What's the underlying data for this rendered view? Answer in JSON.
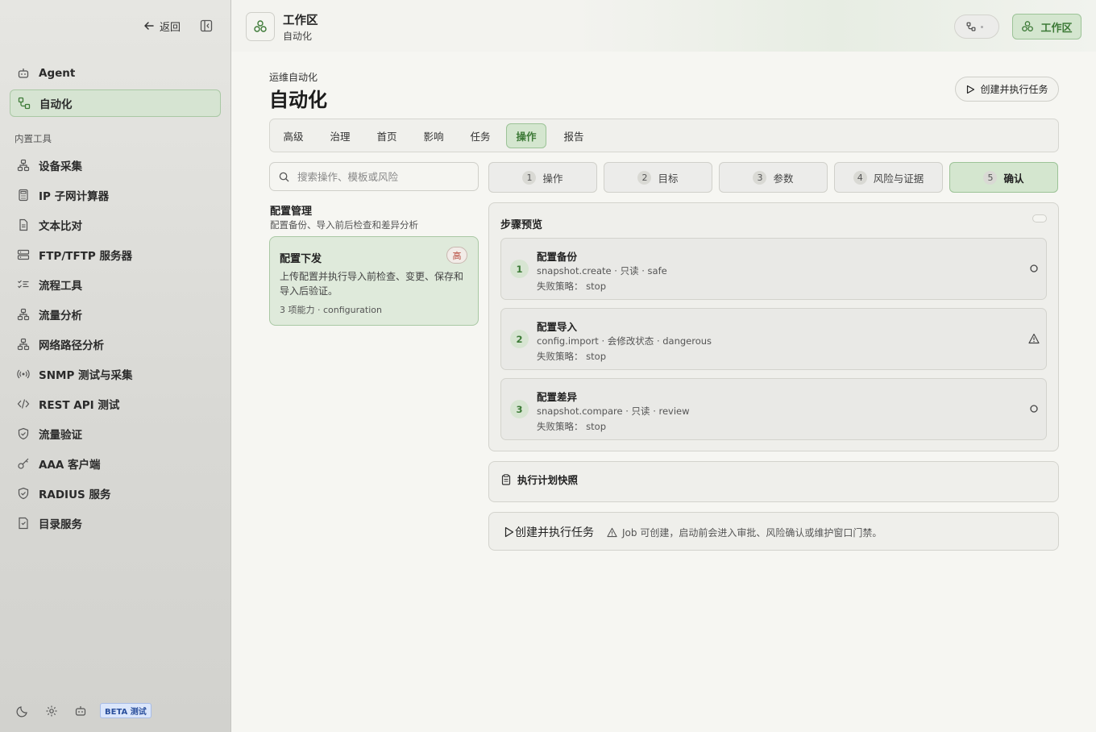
{
  "sidebar": {
    "back_label": "返回",
    "section_label": "内置工具",
    "top_items": [
      {
        "label": "Agent",
        "icon": "robot-icon"
      },
      {
        "label": "自动化",
        "icon": "workflow-icon"
      }
    ],
    "tools": [
      {
        "label": "设备采集",
        "icon": "topology-icon"
      },
      {
        "label": "IP 子网计算器",
        "icon": "calculator-icon"
      },
      {
        "label": "文本比对",
        "icon": "document-icon"
      },
      {
        "label": "FTP/TFTP 服务器",
        "icon": "server-icon"
      },
      {
        "label": "流程工具",
        "icon": "list-check-icon"
      },
      {
        "label": "流量分析",
        "icon": "topology-icon"
      },
      {
        "label": "网络路径分析",
        "icon": "topology-icon"
      },
      {
        "label": "SNMP 测试与采集",
        "icon": "radio-icon"
      },
      {
        "label": "REST API 测试",
        "icon": "code-icon"
      },
      {
        "label": "流量验证",
        "icon": "shield-check-icon"
      },
      {
        "label": "AAA 客户端",
        "icon": "key-icon"
      },
      {
        "label": "RADIUS 服务",
        "icon": "shield-check-icon"
      },
      {
        "label": "目录服务",
        "icon": "directory-icon"
      }
    ],
    "beta_label": "BETA 测试"
  },
  "header": {
    "workspace_title": "工作区",
    "workspace_sub": "自动化",
    "workspace_button": "工作区"
  },
  "page": {
    "overline": "运维自动化",
    "title": "自动化",
    "create_button": "创建并执行任务"
  },
  "tabs": [
    "高级",
    "治理",
    "首页",
    "影响",
    "任务",
    "操作",
    "报告"
  ],
  "active_tab": "操作",
  "search": {
    "placeholder": "搜索操作、模板或风险",
    "value": ""
  },
  "wizard_steps": [
    {
      "num": "1",
      "label": "操作"
    },
    {
      "num": "2",
      "label": "目标"
    },
    {
      "num": "3",
      "label": "参数"
    },
    {
      "num": "4",
      "label": "风险与证据"
    },
    {
      "num": "5",
      "label": "确认"
    }
  ],
  "config": {
    "heading": "配置管理",
    "description": "配置备份、导入前后检查和差异分析",
    "card": {
      "title": "配置下发",
      "risk": "高",
      "text": "上传配置并执行导入前检查、变更、保存和导入后验证。",
      "meta": "3 项能力 · configuration"
    }
  },
  "preview": {
    "title": "步骤预览",
    "steps": [
      {
        "num": "1",
        "title": "配置备份",
        "meta": "snapshot.create · 只读 · safe",
        "policy": "失败策略： stop",
        "icon": "circle-icon"
      },
      {
        "num": "2",
        "title": "配置导入",
        "meta": "config.import · 会修改状态 · dangerous",
        "policy": "失败策略： stop",
        "icon": "warning-icon"
      },
      {
        "num": "3",
        "title": "配置差异",
        "meta": "snapshot.compare · 只读 · review",
        "policy": "失败策略： stop",
        "icon": "circle-icon"
      }
    ]
  },
  "snapshot": {
    "title": "执行计划快照"
  },
  "action": {
    "button": "创建并执行任务",
    "note": "Job 可创建，启动前会进入审批、风险确认或维护窗口门禁。"
  },
  "colors": {
    "accent": "#3d7a37",
    "accent_bg": "#d4e6cf",
    "danger": "#b5483a"
  }
}
